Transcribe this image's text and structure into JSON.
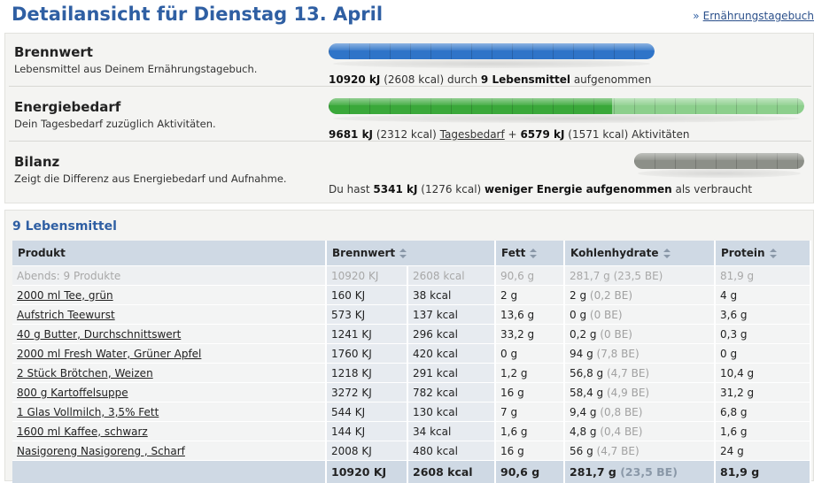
{
  "header": {
    "title": "Detailansicht für Dienstag 13. April",
    "diary_arrow": "»",
    "diary_link": "Ernährungstagebuch"
  },
  "summary": {
    "brennwert": {
      "title": "Brennwert",
      "desc": "Lebensmittel aus Deinem Ernährungstagebuch.",
      "kj": "10920 kJ",
      "kcal": "(2608 kcal)",
      "mid": "durch",
      "count": "9 Lebensmittel",
      "suffix": "aufgenommen",
      "bar_color": "#2f74c8"
    },
    "energiebedarf": {
      "title": "Energiebedarf",
      "desc": "Dein Tagesbedarf zuzüglich Aktivitäten.",
      "base_kj": "9681 kJ",
      "base_kcal": "(2312 kcal)",
      "base_label": "Tagesbedarf",
      "plus": "+",
      "act_kj": "6579 kJ",
      "act_kcal": "(1571 kcal)",
      "act_label": "Aktivitäten",
      "bar_color": "#3aa83a",
      "bar_color_light": "#8ccf8c",
      "base_share": 0.595
    },
    "bilanz": {
      "title": "Bilanz",
      "desc": "Zeigt die Differenz aus Energiebedarf und Aufnahme.",
      "prefix": "Du hast",
      "kj": "5341 kJ",
      "kcal": "(1276 kcal)",
      "emph": "weniger Energie aufgenommen",
      "suffix": "als verbraucht",
      "bar_color": "#8c8f88"
    }
  },
  "foods": {
    "title": "9 Lebensmittel",
    "columns": {
      "produkt": "Produkt",
      "brennwert": "Brennwert",
      "fett": "Fett",
      "kohlenhydrate": "Kohlenhydrate",
      "protein": "Protein"
    },
    "group": {
      "name": "Abends: 9 Produkte",
      "kj": "10920 KJ",
      "kcal": "2608 kcal",
      "fett": "90,6 g",
      "kh": "281,7 g (23,5 BE)",
      "protein": "81,9 g"
    },
    "rows": [
      {
        "name": "2000 ml Tee, grün",
        "kj": "160 KJ",
        "kcal": "38 kcal",
        "fett": "2 g",
        "kh": "2 g",
        "be": "(0,2 BE)",
        "protein": "4 g"
      },
      {
        "name": "Aufstrich Teewurst",
        "kj": "573 KJ",
        "kcal": "137 kcal",
        "fett": "13,6 g",
        "kh": "0 g",
        "be": "(0 BE)",
        "protein": "3,6 g"
      },
      {
        "name": "40 g Butter, Durchschnittswert",
        "kj": "1241 KJ",
        "kcal": "296 kcal",
        "fett": "33,2 g",
        "kh": "0,2 g",
        "be": "(0 BE)",
        "protein": "0,3 g"
      },
      {
        "name": "2000 ml Fresh Water, Grüner Apfel",
        "kj": "1760 KJ",
        "kcal": "420 kcal",
        "fett": "0 g",
        "kh": "94 g",
        "be": "(7,8 BE)",
        "protein": "0 g"
      },
      {
        "name": "2 Stück Brötchen, Weizen",
        "kj": "1218 KJ",
        "kcal": "291 kcal",
        "fett": "1,2 g",
        "kh": "56,8 g",
        "be": "(4,7 BE)",
        "protein": "10,4 g"
      },
      {
        "name": "800 g Kartoffelsuppe",
        "kj": "3272 KJ",
        "kcal": "782 kcal",
        "fett": "16 g",
        "kh": "58,4 g",
        "be": "(4,9 BE)",
        "protein": "31,2 g"
      },
      {
        "name": "1 Glas Vollmilch, 3,5% Fett",
        "kj": "544 KJ",
        "kcal": "130 kcal",
        "fett": "7 g",
        "kh": "9,4 g",
        "be": "(0,8 BE)",
        "protein": "6,8 g"
      },
      {
        "name": "1600 ml Kaffee, schwarz",
        "kj": "144 KJ",
        "kcal": "34 kcal",
        "fett": "1,6 g",
        "kh": "4,8 g",
        "be": "(0,4 BE)",
        "protein": "1,6 g"
      },
      {
        "name": "Nasigoreng Nasigoreng , Scharf",
        "kj": "2008 KJ",
        "kcal": "480 kcal",
        "fett": "16 g",
        "kh": "56 g",
        "be": "(4,7 BE)",
        "protein": "24 g"
      }
    ],
    "total": {
      "kj": "10920 KJ",
      "kcal": "2608 kcal",
      "fett": "90,6 g",
      "kh": "281,7 g",
      "be": "(23,5 BE)",
      "protein": "81,9 g"
    }
  }
}
